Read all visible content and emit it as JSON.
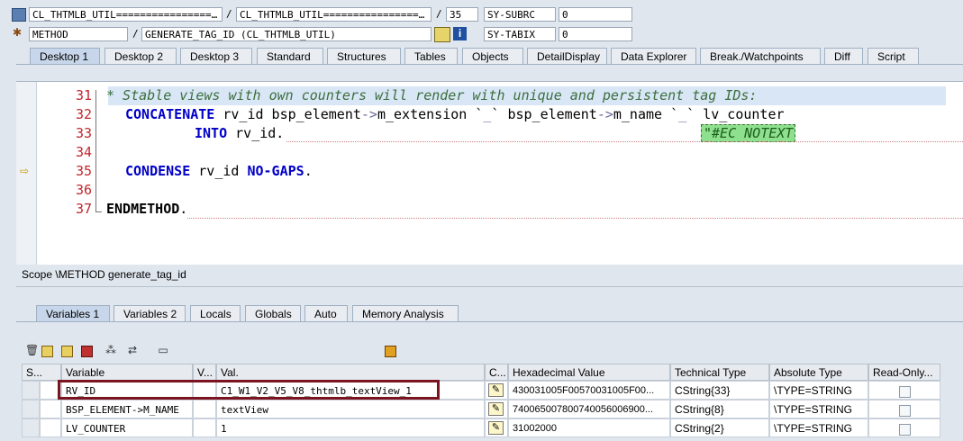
{
  "header": {
    "row1": {
      "program": "CL_THTMLB_UTIL================…",
      "include": "CL_THTMLB_UTIL================…",
      "line": "35",
      "sysfield1_name": "SY-SUBRC",
      "sysfield1_value": "0"
    },
    "row2": {
      "type": "METHOD",
      "name": "GENERATE_TAG_ID (CL_THTMLB_UTIL)",
      "sysfield2_name": "SY-TABIX",
      "sysfield2_value": "0"
    }
  },
  "desktop_tabs": [
    "Desktop 1",
    "Desktop 2",
    "Desktop 3",
    "Standard",
    "Structures",
    "Tables",
    "Objects",
    "DetailDisplay",
    "Data Explorer",
    "Break./Watchpoints",
    "Diff",
    "Script"
  ],
  "code": {
    "line_numbers": [
      "31",
      "32",
      "33",
      "34",
      "35",
      "36",
      "37"
    ],
    "l31_comment": "* Stable views with own counters will render with unique and persistent tag IDs:",
    "l32_kw": "CONCATENATE",
    "l32_a": " rv_id bsp_element",
    "l32_arrow1": "->",
    "l32_b": "m_extension `",
    "l32_us1": "_",
    "l32_c": "` bsp_element",
    "l32_arrow2": "->",
    "l32_d": "m_name `",
    "l32_us2": "_",
    "l32_e": "` lv_counter",
    "l33_kw": "INTO",
    "l33_rest": " rv_id.",
    "l33_pragma": "\"#EC NOTEXT",
    "l35_kw1": "CONDENSE",
    "l35_a": " rv_id ",
    "l35_kw2": "NO-GAPS",
    "l35_end": ".",
    "l37_kw": "ENDMETHOD",
    "l37_end": "."
  },
  "scope": "Scope \\METHOD generate_tag_id",
  "var_tabs": [
    "Variables 1",
    "Variables 2",
    "Locals",
    "Globals",
    "Auto",
    "Memory Analysis"
  ],
  "table": {
    "headers": [
      "S...",
      "Variable",
      "V...",
      "Val.",
      "C...",
      "Hexadecimal Value",
      "Technical Type",
      "Absolute Type",
      "Read-Only..."
    ],
    "rows": [
      {
        "variable": "RV_ID",
        "value": "C1_W1_V2_V5_V8_thtmlb_textView_1",
        "hex": "430031005F00570031005F00...",
        "tech": "CString{33}",
        "abs": "\\TYPE=STRING"
      },
      {
        "variable": "BSP_ELEMENT->M_NAME",
        "value": "textView",
        "hex": "740065007800740056006900...",
        "tech": "CString{8}",
        "abs": "\\TYPE=STRING"
      },
      {
        "variable": "LV_COUNTER",
        "value": "1",
        "hex": "31002000",
        "tech": "CString{2}",
        "abs": "\\TYPE=STRING"
      }
    ]
  },
  "icons": {
    "pencil": "✎",
    "info": "i"
  },
  "colors": {
    "highlight_box": "#7a1420",
    "line_number": "#c1272d",
    "keyword": "#0000c8",
    "comment": "#3c6e3c"
  }
}
